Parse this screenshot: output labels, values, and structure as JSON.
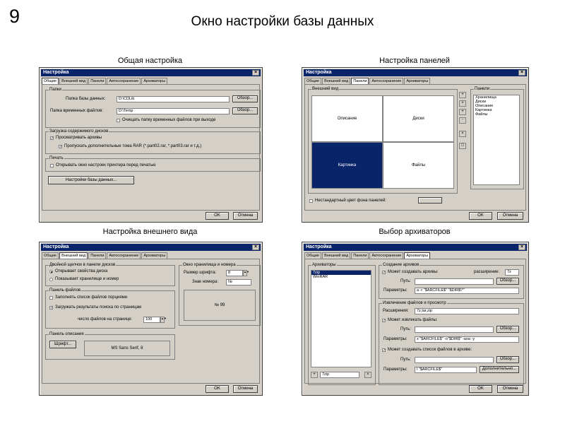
{
  "slide": {
    "number": "9",
    "title": "Окно настройки базы данных"
  },
  "captions": {
    "general": "Общая настройка",
    "panels": "Настройка панелей",
    "appearance": "Настройка внешнего вида",
    "archivers": "Выбор архиваторов"
  },
  "dialog": {
    "title": "Настройка",
    "close": "×",
    "tabs": [
      "Общие",
      "Внешний вид",
      "Панели",
      "Автосохранение",
      "Архиваторы"
    ],
    "ok": "OK",
    "cancel": "Отмена"
  },
  "general": {
    "folders_group": "Папки",
    "db_folder_label": "Папка базы данных:",
    "db_folder_value": "D:\\CDLib",
    "tmp_folder_label": "Папка временных файлов:",
    "tmp_folder_value": "D:\\Temp",
    "browse": "Обзор...",
    "clear_tmp": "Очищать папку временных файлов при выходе",
    "clear_tmp_checked": false,
    "disk_load_group": "Загрузка содержимого дисков",
    "scan_archives": "Просматривать архивы",
    "scan_archives_checked": true,
    "skip_rar": "Пропускать дополнительные тома RAR (*.part02.rar, *.part03.rar и т.д.)",
    "skip_rar_checked": true,
    "print_group": "Печать",
    "printer_settings": "Открывать окно настроек принтера перед печатью",
    "printer_settings_checked": false,
    "db_settings_button": "Настройки базы данных..."
  },
  "panels": {
    "appearance_group": "Внешний вид",
    "cells": [
      "Описание",
      "Диски",
      "Картинка",
      "Файлы"
    ],
    "selected_cell": "Картинка",
    "list_group": "Панели",
    "list_items": [
      "Хранилища",
      "Диски",
      "Описание",
      "Картинка",
      "Файлы"
    ],
    "tool_icons": [
      "+",
      "+",
      "+",
      "+",
      "×",
      "□"
    ],
    "custom_bg": "Нестандартный цвет фона панелей:",
    "custom_bg_checked": false
  },
  "appearance": {
    "dblclick_group": "Двойной щелчок в панели дисков",
    "opt_props": "Открывает свойства диска",
    "opt_storage": "Показывает хранилище и номер",
    "selected_option": "Открывает свойства диска",
    "file_panel_group": "Панель файлов",
    "fill_list": "Заполнять список файлов порциями",
    "fill_list_checked": false,
    "load_pages": "Загружать результаты поиска по страницам",
    "load_pages_checked": true,
    "per_page_label": "число файлов на странице:",
    "per_page_value": "100",
    "desc_group": "Панель описания",
    "font_button": "Шрифт...",
    "font_value": "MS Sans Serif, 8",
    "storage_group": "Окно хранилища и номера",
    "font_size_label": "Размер шрифта:",
    "font_size_value": "8",
    "number_sign_label": "Знак номера:",
    "number_sign_value": "№",
    "preview": "№ 99"
  },
  "archivers": {
    "list_group": "Архиваторы",
    "items": [
      "7zip",
      "WinRAR"
    ],
    "selected": "7zip",
    "add_icon": "+",
    "new_value": "7zip",
    "remove_icon": "×",
    "create_group": "Создание архивов",
    "can_create": "Может создавать архивы:",
    "can_create_checked": true,
    "ext_label": "расширение:",
    "ext_value": "7z",
    "path_label": "Путь:",
    "params_label": "Параметры:",
    "create_params": "a -r \"$ARCFILE$\" \"$DIR$\\*\"",
    "extract_group": "Извлечение файлов и просмотр",
    "ext2_label": "Расширения:",
    "ext2_value": "7z,tar,zip",
    "can_extract": "Может извлекать файлы:",
    "can_extract_checked": true,
    "extract_params": "x \"$ARCFILE$\" -o\"$DIR$\" -aoa -y",
    "can_list": "Может создавать список файлов в архиве:",
    "can_list_checked": true,
    "list_params": "l \"$ARCFILE$\"",
    "more_button": "Дополнительно...",
    "browse": "Обзор..."
  }
}
